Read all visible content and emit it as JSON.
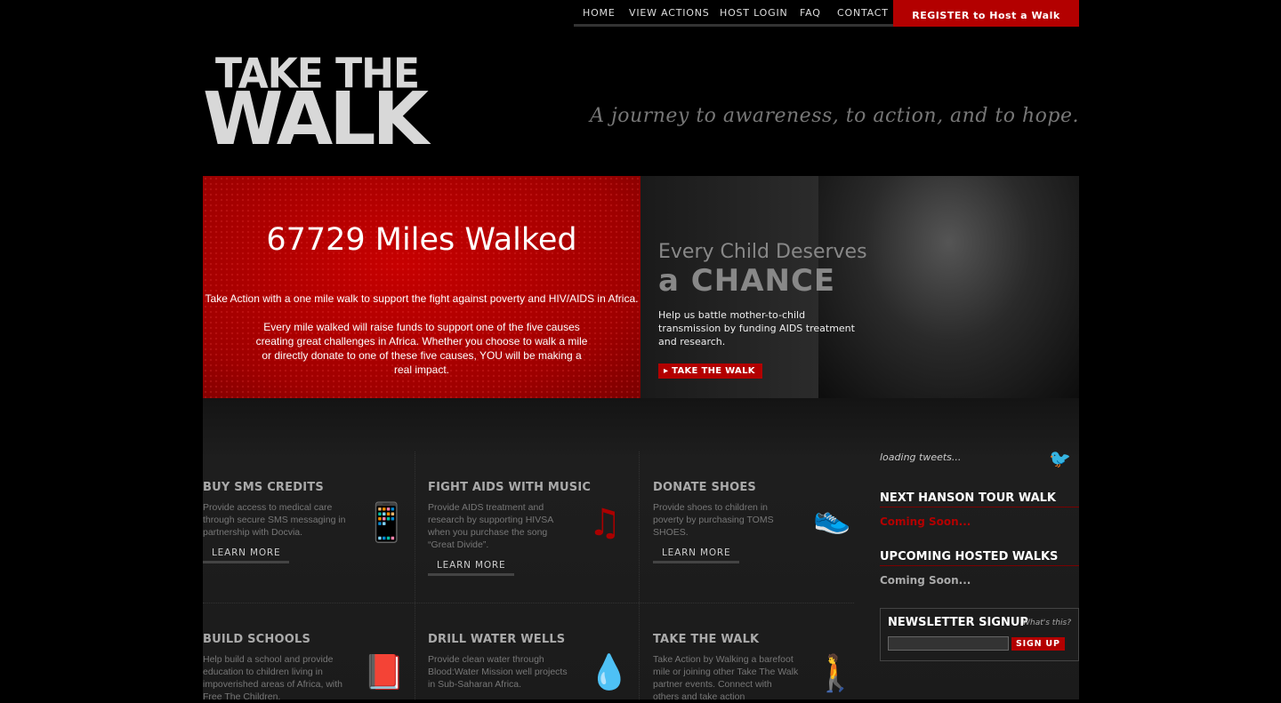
{
  "nav": {
    "items": [
      "HOME",
      "VIEW ACTIONS",
      "HOST LOGIN",
      "FAQ",
      "CONTACT"
    ],
    "register": "REGISTER to Host a Walk"
  },
  "logo": {
    "line1": "TAKE THE",
    "line2": "WALK"
  },
  "tagline": "A journey to awareness, to action, and to hope.",
  "hero": {
    "miles": "67729  Miles Walked",
    "para1": "Take Action with a one mile walk to support the fight against poverty and HIV/AIDS in Africa.",
    "para2": "Every mile walked will raise funds to support one of the five causes creating great challenges in Africa. Whether you choose to walk a mile or directly donate to one of these five causes, YOU will be making a real impact.",
    "promo_line1": "Every Child Deserves",
    "promo_line2": "a CHANCE",
    "promo_desc": "Help us battle mother-to-child transmission by funding AIDS treatment and research.",
    "promo_button": "TAKE THE WALK"
  },
  "causes": [
    {
      "title": "BUY SMS CREDITS",
      "text": "Provide access to medical care through secure SMS messaging in partnership with Docvia.",
      "more": "LEARN MORE",
      "icon": "phone-icon"
    },
    {
      "title": "FIGHT AIDS WITH MUSIC",
      "text": "Provide AIDS treatment and research by supporting HIVSA when you purchase the song “Great Divide”.",
      "more": "LEARN MORE",
      "icon": "music-note-icon"
    },
    {
      "title": "DONATE SHOES",
      "text": "Provide shoes to children in poverty by purchasing TOMS SHOES.",
      "more": "LEARN MORE",
      "icon": "shoe-icon"
    },
    {
      "title": "BUILD SCHOOLS",
      "text": "Help build a school and provide education to children living in impoverished areas of Africa, with Free The Children.",
      "icon": "book-icon"
    },
    {
      "title": "DRILL WATER WELLS",
      "text": "Provide clean water through Blood:Water Mission well projects in Sub-Saharan Africa.",
      "icon": "water-drop-icon"
    },
    {
      "title": "TAKE THE WALK",
      "text": "Take Action by Walking a barefoot mile or joining other Take The Walk partner events. Connect with others and take action",
      "icon": "walker-icon"
    }
  ],
  "sidebar": {
    "tweets": "loading tweets...",
    "next_title": "NEXT HANSON TOUR WALK",
    "next_value": "Coming Soon...",
    "upcoming_title": "UPCOMING HOSTED WALKS",
    "upcoming_value": "Coming Soon...",
    "newsletter_title": "NEWSLETTER SIGNUP",
    "newsletter_whats": "What's this?",
    "newsletter_button": "SIGN UP"
  },
  "colors": {
    "brand_red": "#b30000",
    "background": "#000000"
  }
}
